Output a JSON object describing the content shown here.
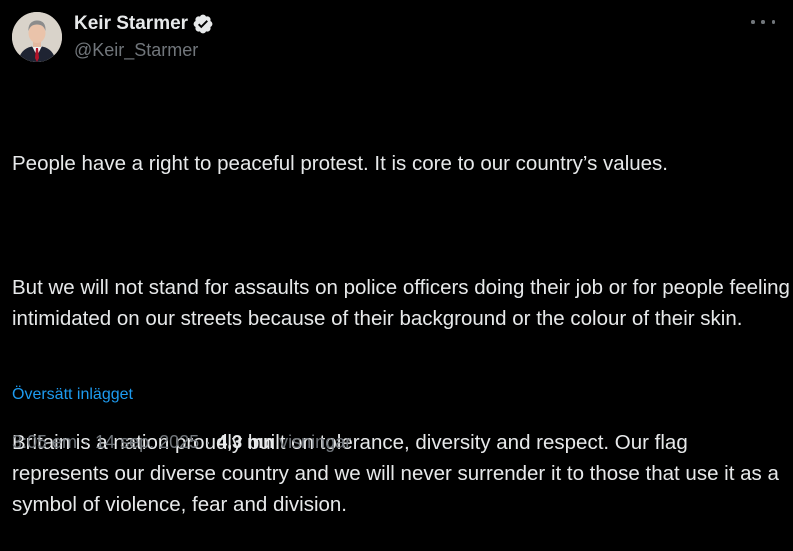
{
  "author": {
    "display_name": "Keir Starmer",
    "handle": "@Keir_Starmer",
    "verified": true,
    "avatar_icon": "profile-photo"
  },
  "tweet": {
    "paragraphs": [
      "People have a right to peaceful protest. It is core to our country’s values.",
      "But we will not stand for assaults on police officers doing their job or for people feeling intimidated on our streets because of their background or the colour of their skin.",
      "Britain is a nation proudly built on tolerance, diversity and respect. Our flag represents our diverse country and we will never surrender it to those that use it as a symbol of violence, fear and division."
    ],
    "translate_label": "Översätt inlägget"
  },
  "meta": {
    "time": "3:05 em",
    "separator": "·",
    "date": "14 sep. 2025",
    "views_count": "4,3 mn",
    "views_label": "visningar"
  },
  "colors": {
    "background": "#000000",
    "text": "#e7e9ea",
    "secondary": "#71767b",
    "link": "#1d9bf0"
  },
  "icons": {
    "more": "more-horizontal-icon",
    "verified": "verified-badge-icon"
  }
}
